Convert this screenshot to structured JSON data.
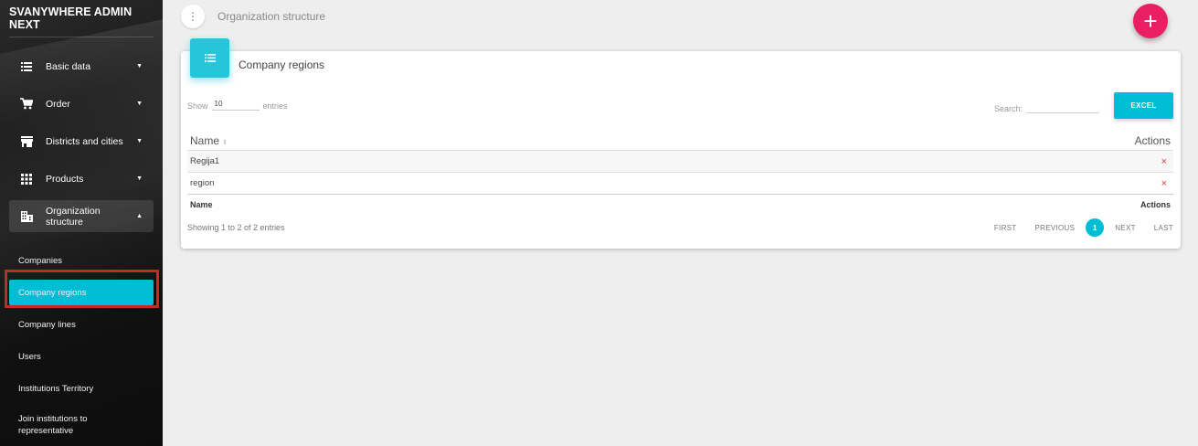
{
  "sidebar": {
    "brand": "SVANYWHERE ADMIN NEXT",
    "menu": [
      {
        "label": "Basic data",
        "icon": "list-icon"
      },
      {
        "label": "Order",
        "icon": "cart-icon"
      },
      {
        "label": "Districts and cities",
        "icon": "store-icon"
      },
      {
        "label": "Products",
        "icon": "grid-icon"
      },
      {
        "label": "Organization structure",
        "icon": "building-icon"
      }
    ],
    "submenu": [
      {
        "label": "Companies"
      },
      {
        "label": "Company regions",
        "active": true
      },
      {
        "label": "Company lines"
      },
      {
        "label": "Users"
      },
      {
        "label": "Institutions Territory"
      },
      {
        "label": "Join institutions to representative"
      }
    ]
  },
  "topbar": {
    "title": "Organization structure",
    "menu_icon": "vertical-dots-icon",
    "fab_icon": "plus-icon",
    "fab_label": "+"
  },
  "card": {
    "title": "Company regions",
    "icon": "list-icon",
    "show_label": "Show",
    "page_length": "10",
    "entries_label": "entries",
    "search_label": "Search:",
    "search_value": "",
    "excel_label": "EXCEL",
    "columns": [
      "Name",
      "Actions"
    ],
    "rows": [
      {
        "name": "Regija1",
        "action": "×"
      },
      {
        "name": "region",
        "action": "×"
      }
    ],
    "info": "Showing 1 to 2 of 2 entries",
    "pagination": {
      "first": "FIRST",
      "previous": "PREVIOUS",
      "current": "1",
      "next": "NEXT",
      "last": "LAST"
    }
  },
  "colors": {
    "accent": "#00bcd4",
    "fab": "#e91e63",
    "highlight": "#c62828",
    "delete": "#e53935"
  }
}
